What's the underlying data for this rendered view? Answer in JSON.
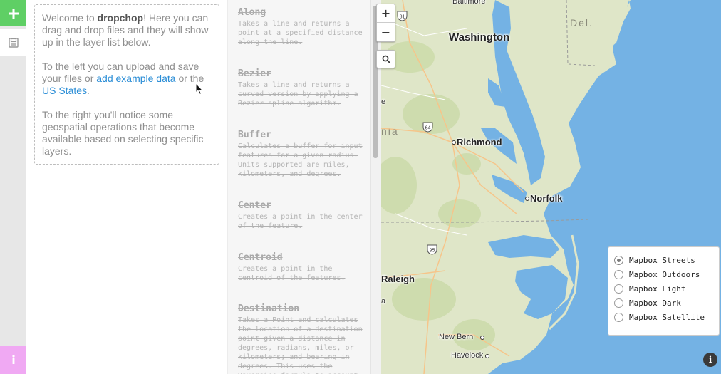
{
  "sidebar": {
    "add_icon": "plus-icon",
    "save_icon": "save-icon",
    "info_icon": "info-icon",
    "colors": {
      "add": "#5fcf65",
      "info": "#f0a9f3"
    }
  },
  "welcome": {
    "p1_pre": "Welcome to ",
    "p1_brand": "dropchop",
    "p1_post": "! Here you can drag and drop files and they will show up in the layer list below.",
    "p2_pre": "To the left you can upload and save your files or ",
    "p2_link1": "add example data",
    "p2_mid": " or the ",
    "p2_link2": "US States",
    "p2_post": ".",
    "p3": "To the right you'll notice some geospatial operations that become available based on selecting specific layers."
  },
  "operations": [
    {
      "name": "Along",
      "description": "Takes a line and returns a point at a specified distance along the line."
    },
    {
      "name": "Bezier",
      "description": "Takes a line and returns a curved version by applying a Bezier spline algorithm."
    },
    {
      "name": "Buffer",
      "description": "Calculates a buffer for input features for a given radius. Units supported are miles, kilometers, and degrees."
    },
    {
      "name": "Center",
      "description": "Creates a point in the center of the feature."
    },
    {
      "name": "Centroid",
      "description": "Creates a point in the centroid of the features."
    },
    {
      "name": "Destination",
      "description": "Takes a Point and calculates the location of a destination point given a distance in degrees, radians, miles, or kilometers; and bearing in degrees. This uses the Haversine formula to account"
    }
  ],
  "map": {
    "zoom_in": "+",
    "zoom_out": "−",
    "labels": {
      "washington": "Washington",
      "richmond": "Richmond",
      "norfolk": "Norfolk",
      "raleigh": "Raleigh",
      "new_bern": "New Bern",
      "havelock": "Havelock",
      "baltimore": "Baltimore",
      "delaware": "Del.",
      "virginia_frag": "nia",
      "state_frag_a": "e",
      "state_frag_b": "a"
    },
    "shields": {
      "i81": "81",
      "i64": "64",
      "i95": "95"
    },
    "colors": {
      "water": "#74b2e4",
      "land": "#dfe6c8"
    }
  },
  "basemaps": {
    "selected": "Mapbox Streets",
    "options": [
      "Mapbox Streets",
      "Mapbox Outdoors",
      "Mapbox Light",
      "Mapbox Dark",
      "Mapbox Satellite"
    ]
  },
  "attribution_icon": "info-circle-icon"
}
